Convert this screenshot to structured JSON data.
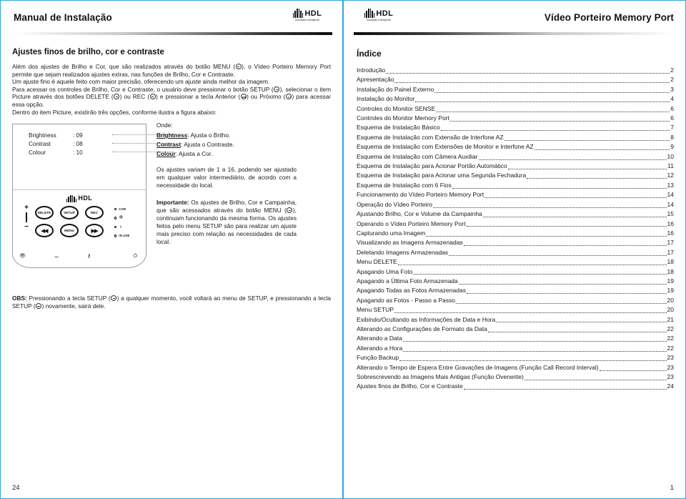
{
  "left_page": {
    "header_title": "Manual de Instalação",
    "logo": {
      "word": "HDL",
      "tagline": "Inovação Inteligente"
    },
    "section_title": "Ajustes finos de brilho, cor e contraste",
    "paragraphs": {
      "p1_a": "Além dos ajustes de Brilho e Cor, que são realizados através do botão MENU (",
      "p1_b": "), o Vídeo Porteiro Memory Port permite que sejam realizados ajustes extras, nas funções de Brilho, Cor e Contraste.",
      "p2": "Um ajuste fino é aquele feito com maior precisão, oferecendo um ajuste ainda melhor da imagem.",
      "p3_a": "Para acessar os controles de Brilho, Cor e Contraste, o usuário deve pressionar o botão SETUP (",
      "p3_b": "), selecionar o item Picture através dos botões DELETE (",
      "p3_c": ") ou REC (",
      "p3_d": ") e pressionar a tecla Anterior (",
      "p3_e": ") ou Próximo (",
      "p3_f": ") para acessar essa opção.",
      "p4": "Dentro do item Picture, existirão três opções, conforme ilustra a figura abaixo:"
    },
    "figure": {
      "screen_rows": [
        {
          "label": "Brightness",
          "value": ": 09"
        },
        {
          "label": "Contrast",
          "value": ": 08"
        },
        {
          "label": "Colour",
          "value": ": 10"
        }
      ],
      "panel_logo": {
        "word": "HDL"
      },
      "buttons": [
        {
          "name": "DELETE",
          "label": "DELETE"
        },
        {
          "name": "SETUP",
          "label": "SETUP"
        },
        {
          "name": "REC",
          "label": "REC"
        },
        {
          "name": "PREV",
          "label": "◀◀"
        },
        {
          "name": "MENU",
          "label": "MENU"
        },
        {
          "name": "NEXT",
          "label": "▶▶"
        }
      ],
      "volume_plus": "+",
      "volume_minus": "−",
      "leds": [
        {
          "label": "COR",
          "icon": ""
        },
        {
          "label": "",
          "icon": "✲"
        },
        {
          "label": "",
          "icon": "♁"
        },
        {
          "label": "IN USE",
          "icon": ""
        }
      ],
      "chin_icons": [
        "👁",
        "⚊",
        "⚷",
        "⏻"
      ]
    },
    "explain": {
      "onde": "Onde:",
      "defs": [
        {
          "term": "Brightness",
          "desc": ": Ajusta o Brilho."
        },
        {
          "term": "Contrast",
          "desc": ": Ajusta o Contraste."
        },
        {
          "term": "Colour",
          "desc": ": Ajusta a Cor."
        }
      ],
      "range_text": "Os ajustes variam de 1 a 16, podendo ser ajustado em qualquer valor intermediário, de acordo com a necessidade do local.",
      "important_label": "Importante:",
      "important_a": " Os ajustes de Brilho, Cor e Campainha, que são acessados através do botão MENU (",
      "important_b": "), continuam funcionando da mesma forma. Os ajustes feitos pelo menu SETUP são para realizar um ajuste mais preciso com relação as necessidades de cada local."
    },
    "obs": {
      "label": "OBS:",
      "a": " Pressionando a tecla SETUP (",
      "b": ") a qualquer momento, você voltará ao menu de SETUP, e pressionando a tecla SETUP (",
      "c": ") novamente, sairá dele."
    },
    "folio": "24"
  },
  "right_page": {
    "header_title": "Vídeo Porteiro Memory Port",
    "logo": {
      "word": "HDL",
      "tagline": "Inovação Inteligente"
    },
    "index_title": "Índice",
    "toc": [
      {
        "title": "Introdução",
        "page": "2"
      },
      {
        "title": "Apresentação",
        "page": "2"
      },
      {
        "title": "Instalação do Painel Externo",
        "page": "3"
      },
      {
        "title": "Instalação do Monitor",
        "page": "4"
      },
      {
        "title": "Controles do Monitor SENSE",
        "page": "6"
      },
      {
        "title": "Controles do Monitor Memory Port",
        "page": "6"
      },
      {
        "title": "Esquema de Instalação Básico",
        "page": "7"
      },
      {
        "title": "Esquema de Instalação com Extensão de Interfone AZ",
        "page": "8"
      },
      {
        "title": "Esquema de Instalação com Extensões de Monitor e Interfone AZ",
        "page": "9"
      },
      {
        "title": "Esquema de Instalação com Câmera Auxiliar",
        "page": "10"
      },
      {
        "title": "Esquema de Instalação para Acionar Portão Automático",
        "page": "11"
      },
      {
        "title": "Esquema de Instalação para Acionar uma Segunda Fechadura",
        "page": "12"
      },
      {
        "title": "Esquema de Instalação com 6 Fios",
        "page": "13"
      },
      {
        "title": "Funcionamento do Vídeo Porteiro Memory Port",
        "page": "14"
      },
      {
        "title": "Operação do Vídeo Porteiro",
        "page": "14"
      },
      {
        "title": "Ajustando Brilho, Cor e Volume da Campainha",
        "page": "15"
      },
      {
        "title": "Operando o Vídeo Porteiro Memory Port",
        "page": "16"
      },
      {
        "title": "Capturando uma Imagem",
        "page": "16"
      },
      {
        "title": "Visualizando as Imagens Armazenadas",
        "page": "17"
      },
      {
        "title": "Deletando Imagens Armazenadas",
        "page": "17"
      },
      {
        "title": "Menu DELETE",
        "page": "18"
      },
      {
        "title": "Apagando Uma Foto",
        "page": "18"
      },
      {
        "title": "Apagando a Última Foto Armazenada",
        "page": "19"
      },
      {
        "title": "Apagando Todas as Fotos Armazenadas",
        "page": "19"
      },
      {
        "title": "Apagando as Fotos - Passo a Passo",
        "page": "20"
      },
      {
        "title": "Menu SETUP",
        "page": "20"
      },
      {
        "title": "Exibindo/Ocultando as Informações de Data e Hora",
        "page": "21"
      },
      {
        "title": "Alterando as Configurações de Formato da Data",
        "page": "22"
      },
      {
        "title": "Alterando a Data",
        "page": "22"
      },
      {
        "title": "Alterando a Hora",
        "page": "22"
      },
      {
        "title": "Função Backup",
        "page": "23"
      },
      {
        "title": "Alterando o Tempo de Espera Entre Gravações de Imagens (Função Call Record Interval)",
        "page": "23"
      },
      {
        "title": "Sobrescrevendo as Imagens Mais Antigas (Função Overwrite)",
        "page": "23"
      },
      {
        "title": "Ajustes finos de Brilho, Cor e Contraste",
        "page": "24"
      }
    ],
    "folio": "1"
  },
  "colors": {
    "page_border": "#29a8de",
    "text": "#1a1a1a",
    "rule_dark": "#0d0d0d"
  }
}
